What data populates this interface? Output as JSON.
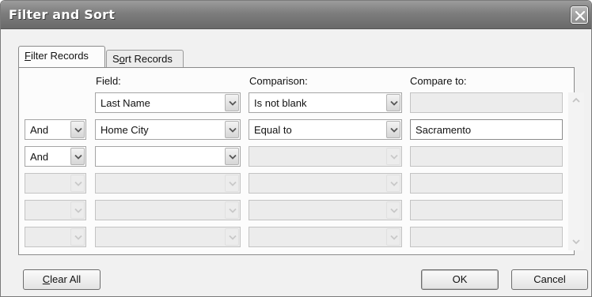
{
  "window": {
    "title": "Filter and Sort"
  },
  "tabs": [
    {
      "label_u": "F",
      "label_rest": "ilter Records",
      "active": true
    },
    {
      "label_pre": "S",
      "label_u": "o",
      "label_rest": "rt Records",
      "active": false
    }
  ],
  "columns": {
    "field": "Field:",
    "comparison": "Comparison:",
    "compare_to": "Compare to:"
  },
  "rows": [
    {
      "andor": "",
      "field": "Last Name",
      "comparison": "Is not blank",
      "compare_to": ""
    },
    {
      "andor": "And",
      "field": "Home City",
      "comparison": "Equal to",
      "compare_to": "Sacramento"
    },
    {
      "andor": "And",
      "field": "",
      "comparison": "",
      "compare_to": ""
    },
    {
      "andor": "",
      "field": "",
      "comparison": "",
      "compare_to": ""
    },
    {
      "andor": "",
      "field": "",
      "comparison": "",
      "compare_to": ""
    },
    {
      "andor": "",
      "field": "",
      "comparison": "",
      "compare_to": ""
    }
  ],
  "buttons": {
    "clear_all_u": "C",
    "clear_all_rest": "lear All",
    "ok": "OK",
    "cancel": "Cancel"
  },
  "icons": {
    "close": "close-icon",
    "dropdown": "chevron-down-icon",
    "scroll_up": "chevron-up-icon",
    "scroll_down": "chevron-down-icon"
  }
}
